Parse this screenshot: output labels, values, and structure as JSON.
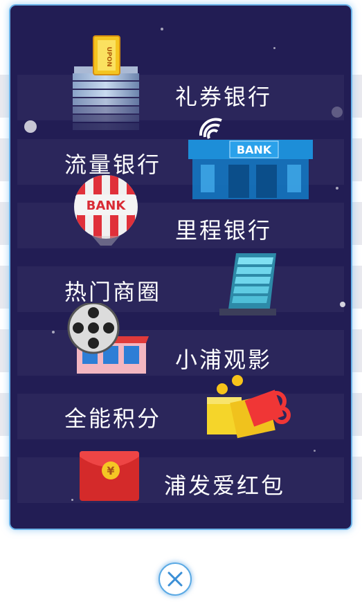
{
  "menu": {
    "items": [
      {
        "label": "礼券银行",
        "icon": "coupon-building-icon"
      },
      {
        "label": "流量银行",
        "icon": "wifi-bank-icon"
      },
      {
        "label": "里程银行",
        "icon": "hot-air-balloon-bank-icon"
      },
      {
        "label": "热门商圈",
        "icon": "skyscraper-icon"
      },
      {
        "label": "小浦观影",
        "icon": "film-reel-cinema-icon"
      },
      {
        "label": "全能积分",
        "icon": "gift-box-icon"
      },
      {
        "label": "浦发爱红包",
        "icon": "red-envelope-icon"
      }
    ],
    "coupon_text": "UPON",
    "bank_text": "BANK",
    "balloon_text": "BANK",
    "envelope_symbol": "¥"
  },
  "close": {
    "icon": "close-icon"
  },
  "colors": {
    "panel": "#221d54",
    "border": "#6ab2e8",
    "text": "#ffffff"
  }
}
